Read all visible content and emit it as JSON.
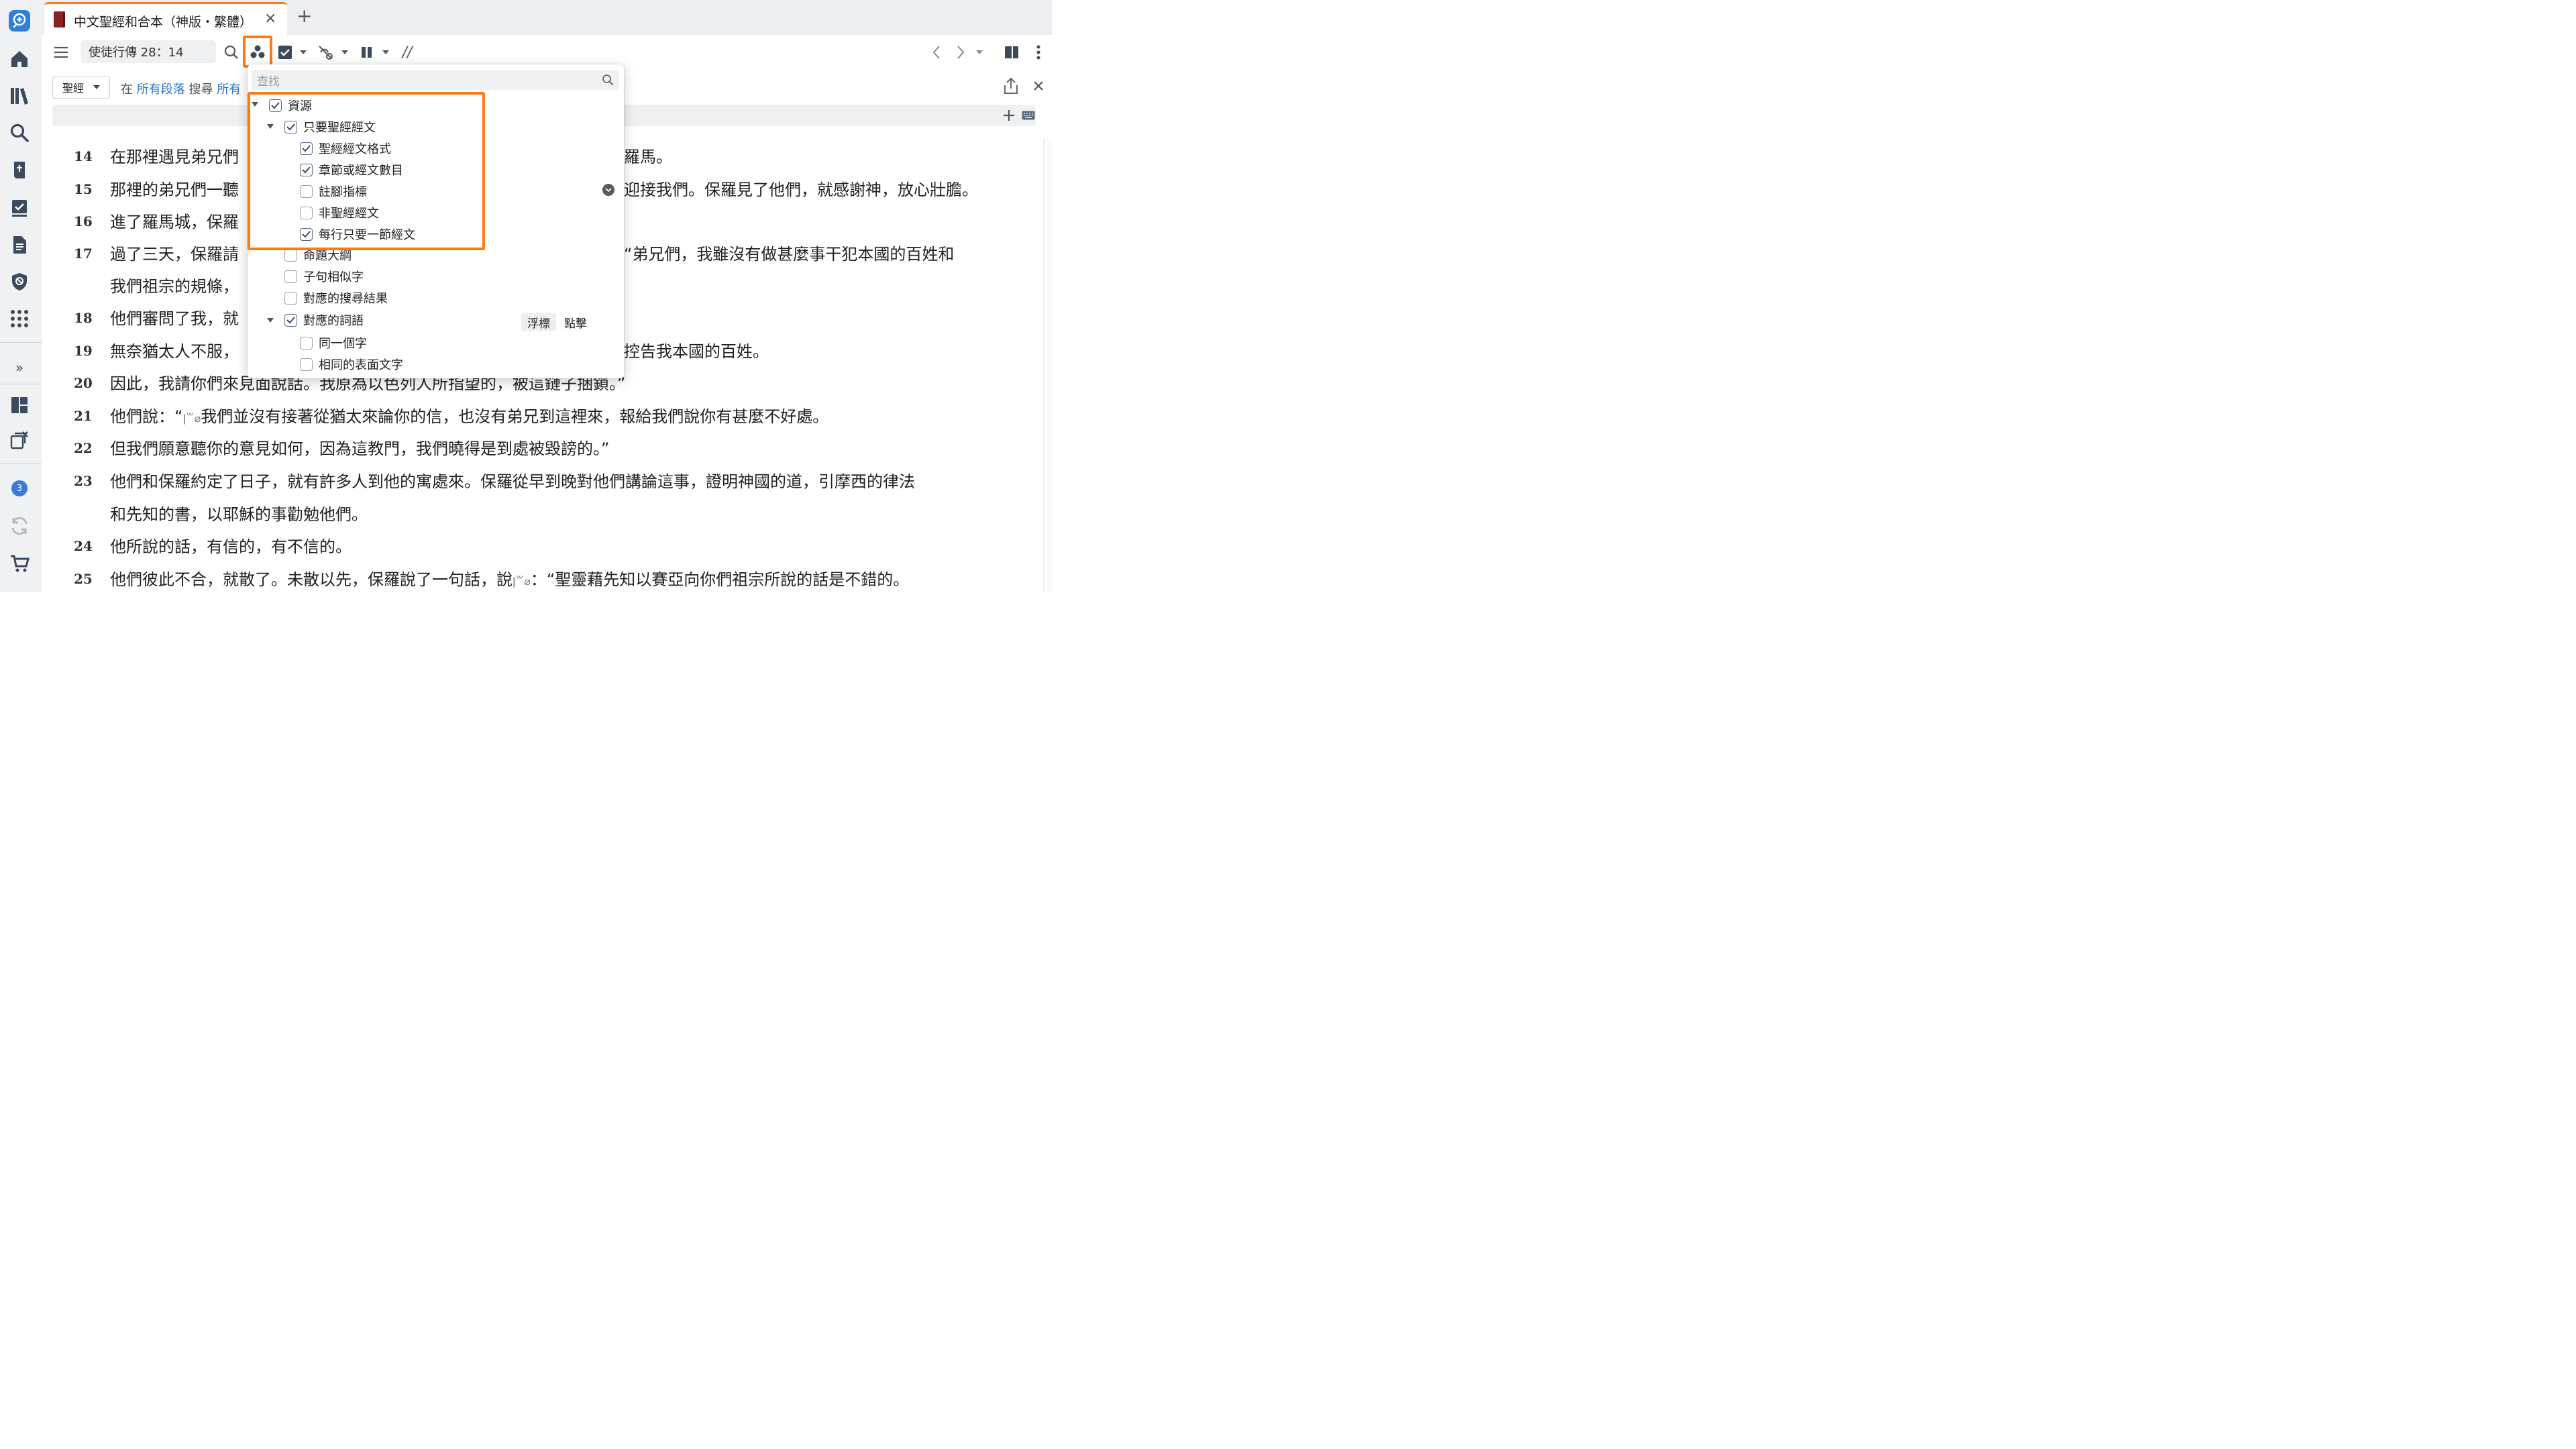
{
  "tab": {
    "title": "中文聖經和合本（神版・繁體）",
    "close": "×",
    "add": "+"
  },
  "toolbar": {
    "reference": "使徒行傳 28：14",
    "parallel_label": "//"
  },
  "search": {
    "scope_label": "聖經",
    "prefix": "在",
    "where": "所有段落",
    "middle": "搜尋",
    "what": "所有"
  },
  "dropdown": {
    "search_placeholder": "查找",
    "items": [
      {
        "label": "資源",
        "checked": true,
        "level": 0,
        "expandable": true
      },
      {
        "label": "只要聖經經文",
        "checked": true,
        "level": 1,
        "expandable": true
      },
      {
        "label": "聖經經文格式",
        "checked": true,
        "level": 2
      },
      {
        "label": "章節或經文數目",
        "checked": true,
        "level": 2
      },
      {
        "label": "註腳指標",
        "checked": false,
        "level": 2
      },
      {
        "label": "非聖經經文",
        "checked": false,
        "level": 2
      },
      {
        "label": "每行只要一節經文",
        "checked": true,
        "level": 2
      },
      {
        "label": "命題大綱",
        "checked": false,
        "level": 1
      },
      {
        "label": "子句相似字",
        "checked": false,
        "level": 1
      },
      {
        "label": "對應的搜尋結果",
        "checked": false,
        "level": 1
      },
      {
        "label": "對應的詞語",
        "checked": true,
        "level": 1,
        "expandable": true
      },
      {
        "label": "同一個字",
        "checked": false,
        "level": 2
      },
      {
        "label": "相同的表面文字",
        "checked": false,
        "level": 2
      }
    ],
    "hover_label": "浮標",
    "click_label": "點擊"
  },
  "sidebar": {
    "badge": "3",
    "expand": "»"
  },
  "verses": [
    {
      "num": "14",
      "left": "在那裡遇見弟兄們",
      "right": "羅馬。"
    },
    {
      "num": "15",
      "left": "那裡的弟兄們一聽",
      "right": "迎接我們。保羅見了他們，就感謝神，放心壯膽。"
    },
    {
      "num": "16",
      "left": "進了羅馬城，保羅",
      "right": ""
    },
    {
      "num": "17",
      "left": "過了三天，保羅請",
      "right": "“弟兄們，我雖沒有做甚麼事干犯本國的百姓和"
    },
    {
      "num": "",
      "left": "我們祖宗的規條，",
      "right": ""
    },
    {
      "num": "18",
      "left": "他們審問了我，就",
      "right": ""
    },
    {
      "num": "19",
      "left": "無奈猶太人不服，",
      "right": "控告我本國的百姓。"
    },
    {
      "num": "20",
      "left": "因此，我請你們來見面說話。我原為以色列人所指望的，被這鏈子捆鎖。”",
      "right": ""
    },
    {
      "num": "21",
      "left": "他們說：“",
      "mark": "“ǀ꒳⌀",
      "rest": "我們並沒有接著從猶太來論你的信，也沒有弟兄到這裡來，報給我們說你有甚麼不好處。"
    },
    {
      "num": "22",
      "left": "但我們願意聽你的意見如何，因為這教門，我們曉得是到處被毀謗的。”",
      "right": ""
    },
    {
      "num": "23",
      "left": "他們和保羅約定了日子，就有許多人到他的寓處來。保羅從早到晚對他們講論這事，證明神國的道，引摩西的律法",
      "right": ""
    },
    {
      "num": "",
      "left": "和先知的書，以耶穌的事勸勉他們。",
      "right": ""
    },
    {
      "num": "24",
      "left": "他所說的話，有信的，有不信的。",
      "right": ""
    },
    {
      "num": "25",
      "left": "他們彼此不合，就散了。未散以先，保羅說了一句話，說",
      "rest": "：“聖靈藉先知以賽亞向你們祖宗所說的話是不錯的。"
    }
  ]
}
